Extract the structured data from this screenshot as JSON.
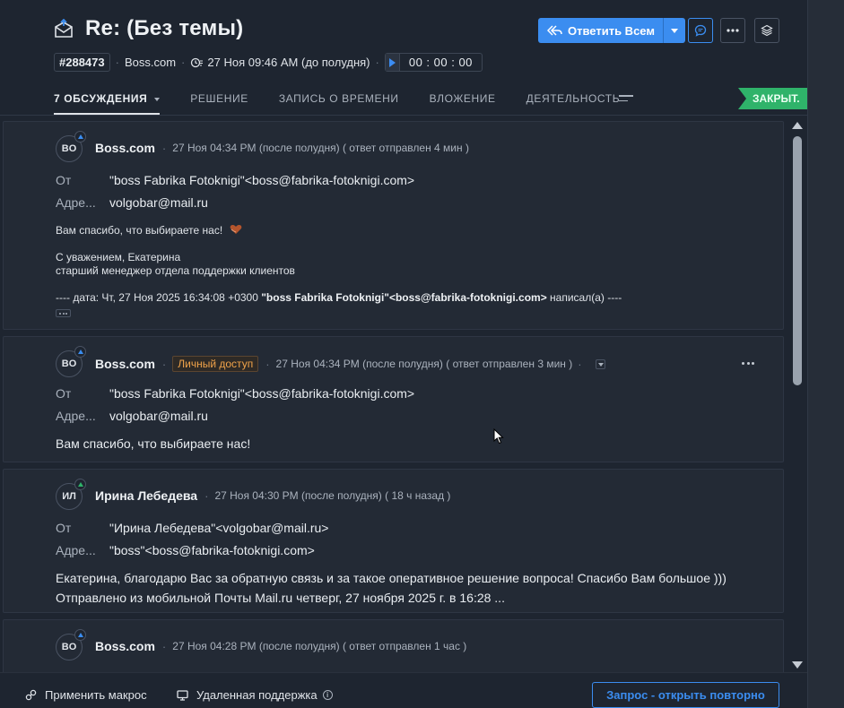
{
  "header": {
    "title": "Re: (Без темы)",
    "ticket_id": "#288473",
    "company": "Boss.com",
    "created": "27 Ноя 09:46 AM (до полудня)",
    "timer": "00 : 00 : 00",
    "reply_all_label": "Ответить Всем",
    "status_badge": "ЗАКРЫТ."
  },
  "tabs": [
    {
      "label": "7 ОБСУЖДЕНИЯ"
    },
    {
      "label": "РЕШЕНИЕ"
    },
    {
      "label": "ЗАПИСЬ О ВРЕМЕНИ"
    },
    {
      "label": "ВЛОЖЕНИЕ"
    },
    {
      "label": "ДЕЯТЕЛЬНОСТЬ"
    }
  ],
  "messages": [
    {
      "initials": "BO",
      "sender": "Boss.com",
      "time": "27 Ноя 04:34 PM (после полудня) ( ответ отправлен 4 мин )",
      "from_label": "От",
      "from": "\"boss Fabrika Fotoknigi\"<boss@fabrika-fotoknigi.com>",
      "to_label": "Адре...",
      "to": "volgobar@mail.ru",
      "body_line1": "Вам спасибо, что выбираете нас!",
      "body_line2": "С уважением, Екатерина",
      "body_line3": "старший менеджер отдела поддержки клиентов",
      "quote_prefix": "---- дата: Чт, 27 Ноя 2025 16:34:08 +0300 ",
      "quote_bold": "\"boss Fabrika Fotoknigi\"<boss@fabrika-fotoknigi.com>",
      "quote_suffix": " написал(а) ----"
    },
    {
      "initials": "BO",
      "sender": "Boss.com",
      "private_label": "Личный доступ",
      "time": "27 Ноя 04:34 PM (после полудня) ( ответ отправлен 3 мин )",
      "from_label": "От",
      "from": "\"boss Fabrika Fotoknigi\"<boss@fabrika-fotoknigi.com>",
      "to_label": "Адре...",
      "to": "volgobar@mail.ru",
      "body": "Вам спасибо, что выбираете нас!"
    },
    {
      "initials": "ИЛ",
      "sender": "Ирина Лебедева",
      "time": "27 Ноя 04:30 PM (после полудня) ( 18 ч назад )",
      "from_label": "От",
      "from": "\"Ирина Лебедева\"<volgobar@mail.ru>",
      "to_label": "Адре...",
      "to": "\"boss\"<boss@fabrika-fotoknigi.com>",
      "body": "Екатерина, благодарю Вас за обратную связь и за такое оперативное решение вопроса! Спасибо Вам большое ))) Отправлено из мобильной Почты Mail.ru четверг, 27 ноября 2025 г. в 16:28 ..."
    },
    {
      "initials": "BO",
      "sender": "Boss.com",
      "time": "27 Ноя 04:28 PM (после полудня) ( ответ отправлен 1 час )"
    }
  ],
  "footer": {
    "macro_label": "Применить макрос",
    "remote_label": "Удаленная поддержка",
    "reopen_label": "Запрос - открыть повторно"
  },
  "colors": {
    "accent": "#3b8df0",
    "closed": "#2fb36a",
    "private": "#f0a34a",
    "background": "#1e2530"
  }
}
